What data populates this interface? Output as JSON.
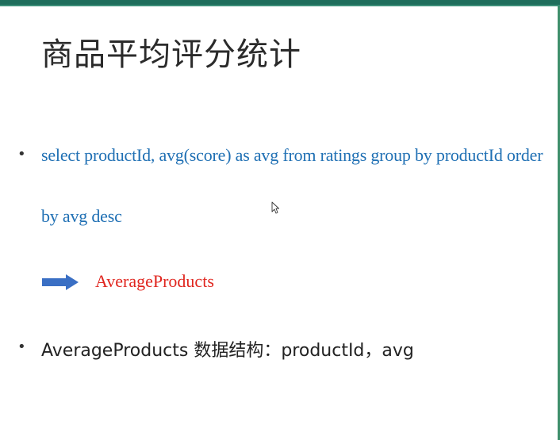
{
  "slide": {
    "title": "商品平均评分统计",
    "sql_bullet": {
      "bullet": "•",
      "line1": "select productId, avg(score) as avg from ratings group by productId order",
      "line2": "by avg desc"
    },
    "result_label": "AverageProducts",
    "structure_bullet": {
      "bullet": "•",
      "text": "AverageProducts 数据结构：productId，avg"
    }
  },
  "colors": {
    "top_bar": "#1f6e5c",
    "sql_text": "#2070b4",
    "result_text": "#e0261f",
    "arrow": "#3a6fc4"
  },
  "icons": {
    "arrow": "right-arrow-icon",
    "cursor": "mouse-pointer-icon"
  }
}
